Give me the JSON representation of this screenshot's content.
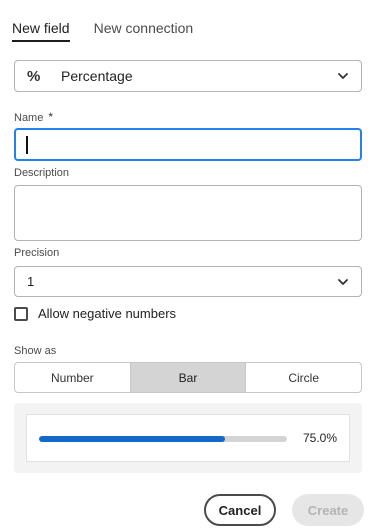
{
  "tabs": [
    {
      "label": "New field",
      "active": true
    },
    {
      "label": "New connection",
      "active": false
    }
  ],
  "field_type": {
    "icon": "percent-icon",
    "value": "Percentage"
  },
  "name": {
    "label": "Name",
    "required_mark": "*",
    "value": ""
  },
  "description": {
    "label": "Description",
    "value": ""
  },
  "precision": {
    "label": "Precision",
    "value": "1"
  },
  "allow_negative": {
    "label": "Allow negative numbers",
    "checked": false
  },
  "show_as": {
    "label": "Show as",
    "options": [
      "Number",
      "Bar",
      "Circle"
    ],
    "selected": "Bar"
  },
  "preview": {
    "percent_value": 75.0,
    "display": "75.0%"
  },
  "colors": {
    "accent": "#2680eb",
    "bar_fill": "#1468c9",
    "bar_track": "#d4d4d4"
  },
  "buttons": {
    "cancel": "Cancel",
    "create": "Create"
  }
}
